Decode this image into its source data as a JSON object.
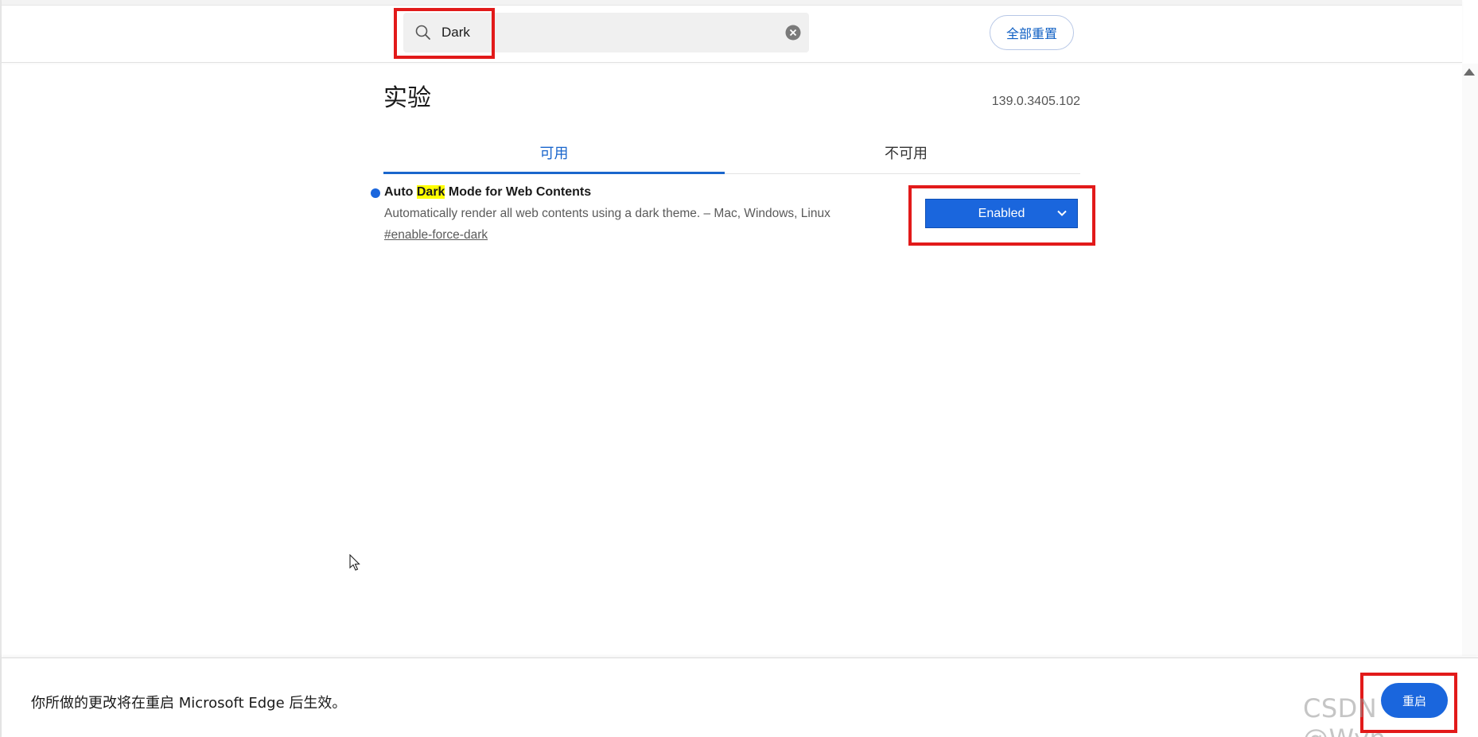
{
  "header": {
    "search": {
      "value": "Dark",
      "placeholder": ""
    },
    "reset_all_label": "全部重置"
  },
  "main": {
    "title": "实验",
    "version": "139.0.3405.102",
    "tabs": [
      {
        "label": "可用",
        "selected": true
      },
      {
        "label": "不可用",
        "selected": false
      }
    ],
    "flags": [
      {
        "name_before": "Auto ",
        "name_highlight": "Dark",
        "name_after": " Mode for Web Contents",
        "description": "Automatically render all web contents using a dark theme. – Mac, Windows, Linux",
        "link": "#enable-force-dark",
        "state": "Enabled"
      }
    ]
  },
  "footer": {
    "message": "你所做的更改将在重启 Microsoft Edge 后生效。",
    "relaunch_label": "重启"
  },
  "watermark": "CSDN @Wyn_",
  "colors": {
    "accent": "#1a66dd",
    "highlight": "#ffff00",
    "annotation_red": "#e21a1a"
  }
}
